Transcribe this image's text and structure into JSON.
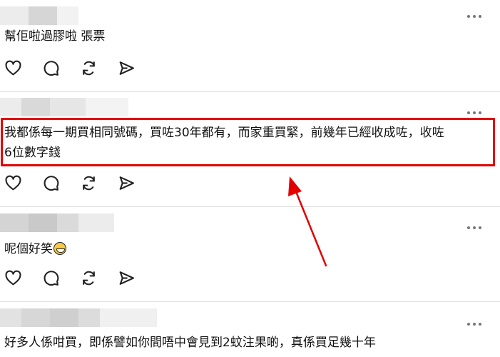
{
  "comments": [
    {
      "text": "幫佢啦過膠啦 張票"
    },
    {
      "text_line1": "我都係每一期買相同號碼，買咗30年都有，而家重買緊，前幾年已經收成咗，收咗",
      "text_line2": "6位數字錢"
    },
    {
      "text": "呢個好笑",
      "emoji": "grinning-face-emoji"
    },
    {
      "text": "好多人係咁買，即係譬如你間唔中會見到2蚊注果啲，真係買足幾十年"
    }
  ],
  "actions": [
    "heart-icon",
    "comment-icon",
    "repost-icon",
    "share-icon"
  ],
  "colors": {
    "highlight": "#e30000",
    "arrow": "#e30000",
    "divider": "#dedede",
    "icon": "#222222",
    "text": "#111111"
  }
}
